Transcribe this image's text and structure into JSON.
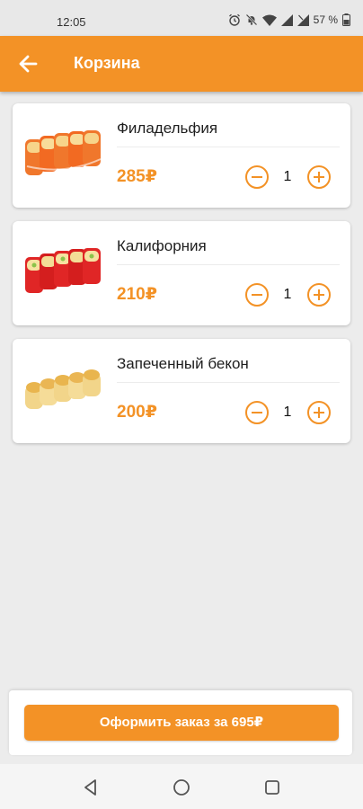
{
  "status_bar": {
    "time": "12:05",
    "battery": "57 %"
  },
  "app_bar": {
    "title": "Корзина",
    "back_icon": "arrow-left-icon"
  },
  "colors": {
    "accent": "#f39226",
    "background": "#ececec",
    "card": "#ffffff"
  },
  "cart": {
    "items": [
      {
        "name": "Филадельфия",
        "price": "285₽",
        "quantity": "1",
        "image": "philadelphia-roll-image"
      },
      {
        "name": "Калифорния",
        "price": "210₽",
        "quantity": "1",
        "image": "california-roll-image"
      },
      {
        "name": "Запеченный бекон",
        "price": "200₽",
        "quantity": "1",
        "image": "baked-bacon-roll-image"
      }
    ]
  },
  "checkout": {
    "button_label": "Оформить заказ за 695₽"
  },
  "nav_bar": {
    "icons": [
      "back-triangle-icon",
      "home-circle-icon",
      "recents-square-icon"
    ]
  }
}
